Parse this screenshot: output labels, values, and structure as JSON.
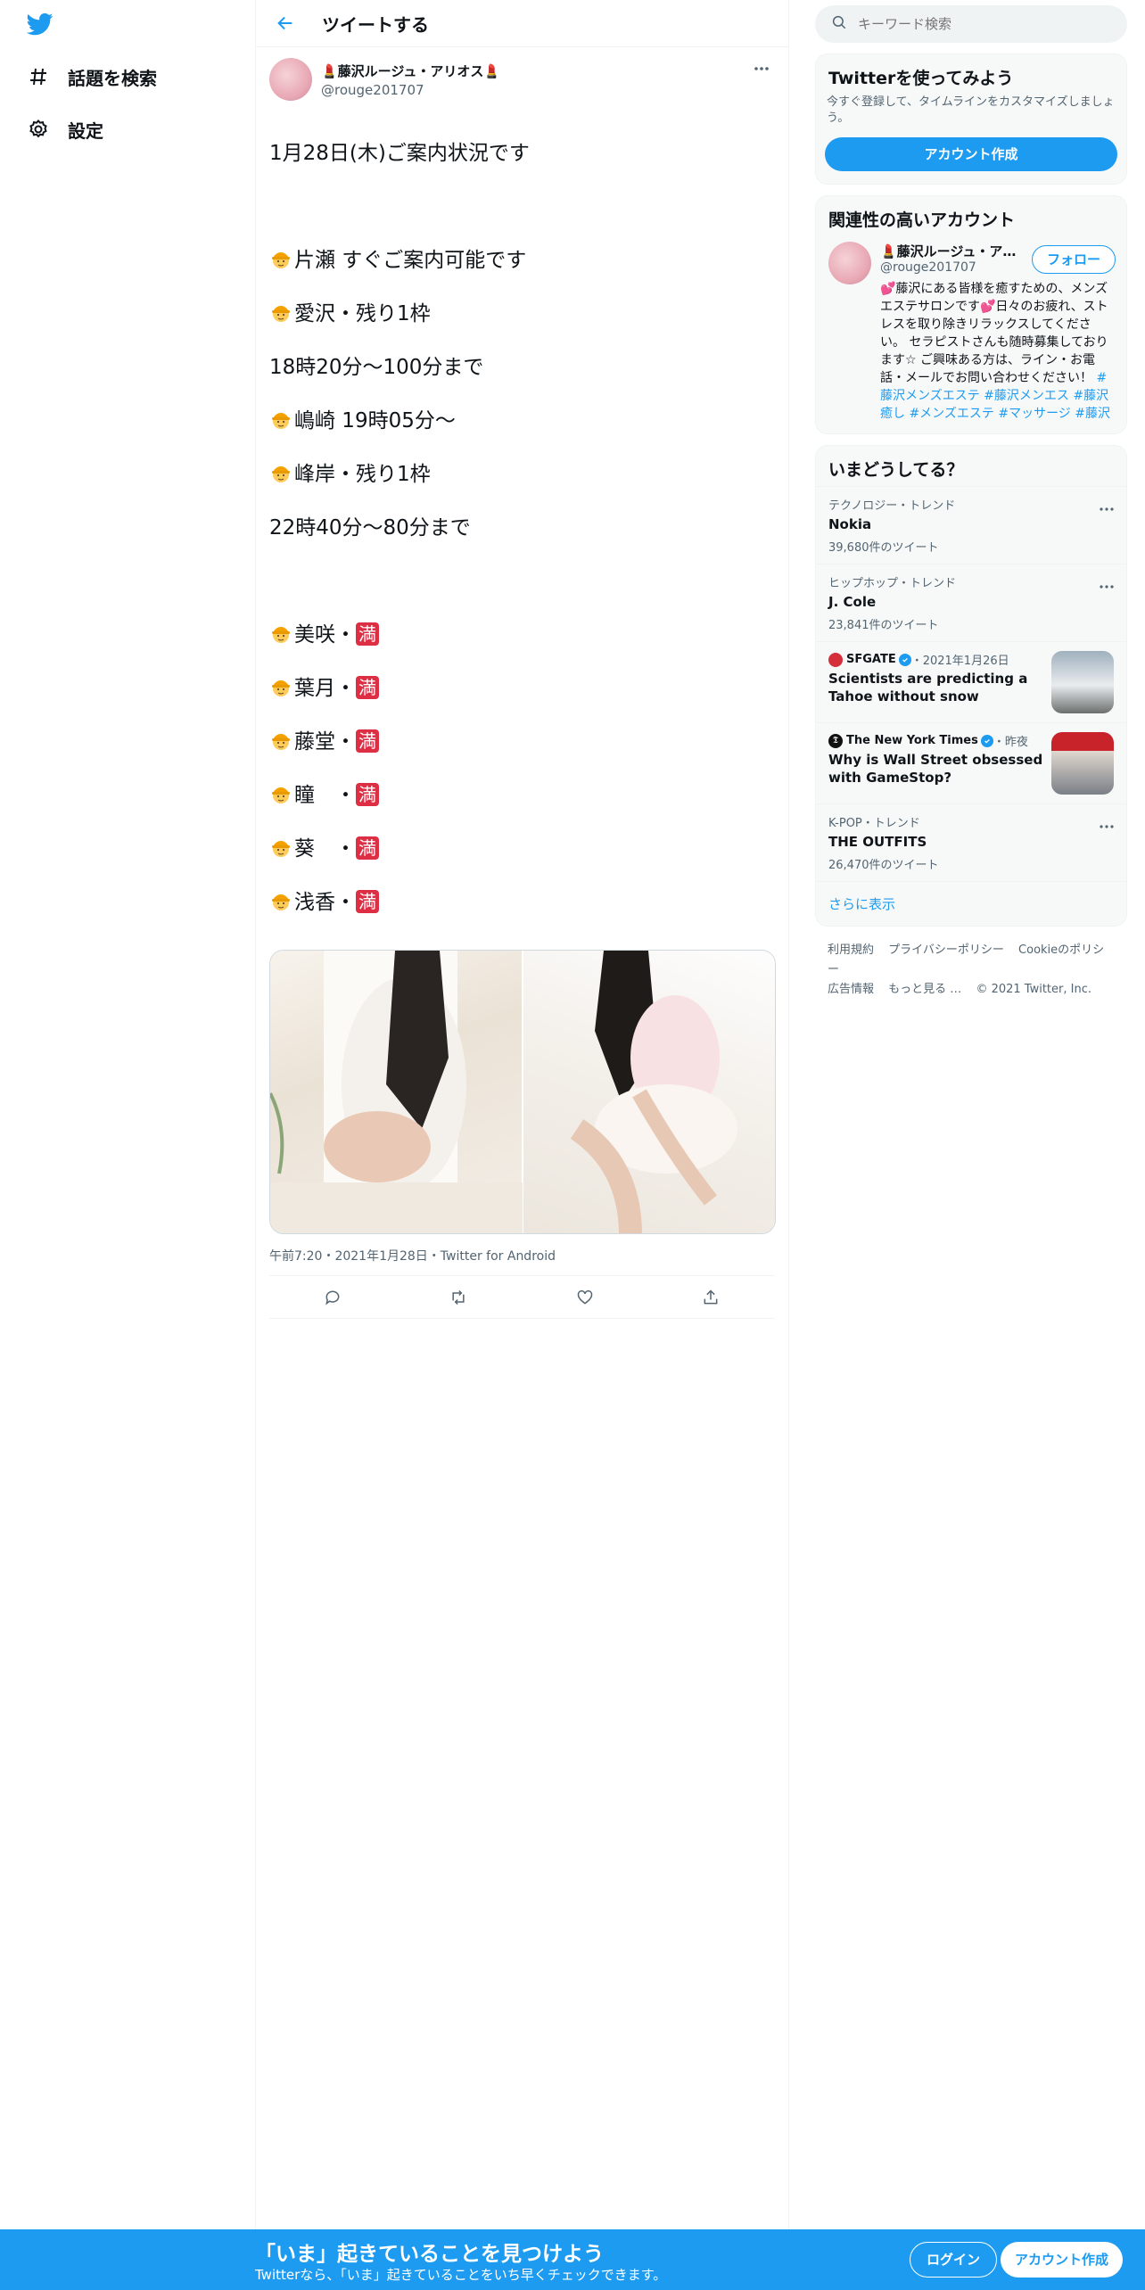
{
  "nav": {
    "explore_label": "話題を検索",
    "settings_label": "設定"
  },
  "header": {
    "title": "ツイートする"
  },
  "tweet": {
    "display_name": "💄藤沢ルージュ・アリオス💄",
    "handle": "@rouge201707",
    "lines": [
      "1月28日(木)ご案内状況です",
      "",
      "片瀬 すぐご案内可能です",
      "愛沢・残り1枠",
      "18時20分～100分まで",
      "嶋崎 19時05分～",
      "峰岸・残り1枠",
      "22時40分～80分まで",
      "",
      "美咲・",
      "葉月・",
      "藤堂・",
      "瞳　・",
      "葵　・",
      "浅香・"
    ],
    "full_badge": "満",
    "meta": "午前7:20・2021年1月28日・Twitter for Android"
  },
  "search": {
    "placeholder": "キーワード検索"
  },
  "signup_card": {
    "title": "Twitterを使ってみよう",
    "subtitle": "今すぐ登録して、タイムラインをカスタマイズしましょう。",
    "button": "アカウント作成"
  },
  "relevant": {
    "title": "関連性の高いアカウント",
    "name": "💄藤沢ルージュ・アリオス💄",
    "handle": "@rouge201707",
    "follow": "フォロー",
    "bio": "💕藤沢にある皆様を癒すための、メンズエステサロンです💕日々のお疲れ、ストレスを取り除きリラックスしてください。 セラピストさんも随時募集しております☆ ご興味ある方は、ライン・お電話・メールでお問い合わせください！",
    "tags": "#藤沢メンズエステ #藤沢メンエス #藤沢癒し #メンズエステ #マッサージ #藤沢"
  },
  "trends": {
    "title": "いまどうしてる？",
    "items": [
      {
        "ctx": "テクノロジー・トレンド",
        "name": "Nokia",
        "count": "39,680件のツイート"
      },
      {
        "ctx": "ヒップホップ・トレンド",
        "name": "J. Cole",
        "count": "23,841件のツイート"
      }
    ],
    "news": [
      {
        "source": "SFGATE",
        "time": "・2021年1月26日",
        "headline": "Scientists are predicting a Tahoe without snow"
      },
      {
        "source": "The New York Times",
        "time": "・昨夜",
        "headline": "Why is Wall Street obsessed with GameStop?"
      }
    ],
    "last": {
      "ctx": "K-POP・トレンド",
      "name": "THE OUTFITS",
      "count": "26,470件のツイート"
    },
    "show_more": "さらに表示"
  },
  "footer": {
    "terms": "利用規約",
    "privacy": "プライバシーポリシー",
    "cookie": "Cookieのポリシー",
    "ads": "広告情報",
    "more": "もっと見る …",
    "copyright": "© 2021 Twitter, Inc."
  },
  "bottom": {
    "title": "「いま」起きていることを見つけよう",
    "subtitle": "Twitterなら、「いま」起きていることをいち早くチェックできます。",
    "login": "ログイン",
    "signup": "アカウント作成"
  },
  "colors": {
    "accent": "#1d9bf0",
    "full_badge": "#dd2e44"
  }
}
